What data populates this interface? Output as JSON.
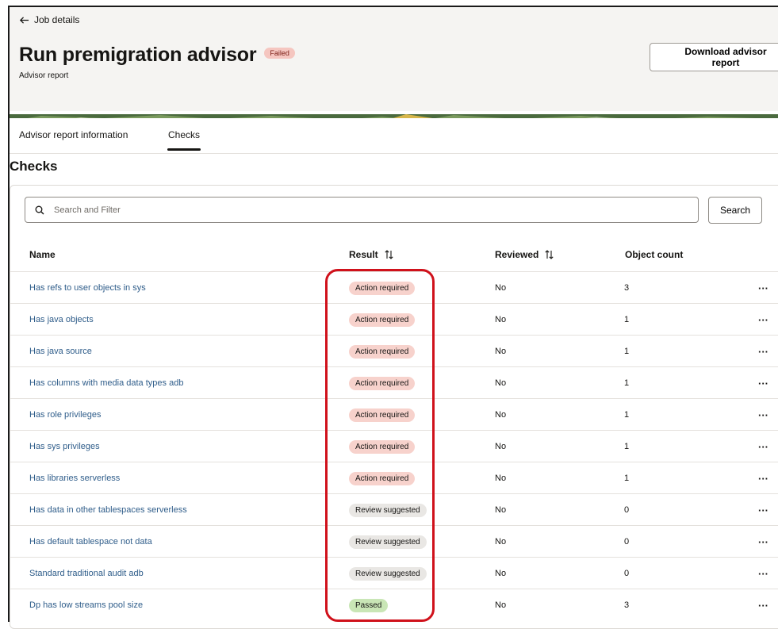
{
  "header": {
    "back_label": "Job details",
    "title": "Run premigration advisor",
    "status": "Failed",
    "subtitle": "Advisor report",
    "download_label": "Download advisor report"
  },
  "tabs": [
    {
      "label": "Advisor report information",
      "active": false
    },
    {
      "label": "Checks",
      "active": true
    }
  ],
  "section_title": "Checks",
  "search": {
    "placeholder": "Search and Filter",
    "button_label": "Search"
  },
  "columns": {
    "name": "Name",
    "result": "Result",
    "reviewed": "Reviewed",
    "object_count": "Object count"
  },
  "rows": [
    {
      "name": "Has refs to user objects in sys",
      "result": "Action required",
      "reviewed": "No",
      "count": "3"
    },
    {
      "name": "Has java objects",
      "result": "Action required",
      "reviewed": "No",
      "count": "1"
    },
    {
      "name": "Has java source",
      "result": "Action required",
      "reviewed": "No",
      "count": "1"
    },
    {
      "name": "Has columns with media data types adb",
      "result": "Action required",
      "reviewed": "No",
      "count": "1"
    },
    {
      "name": "Has role privileges",
      "result": "Action required",
      "reviewed": "No",
      "count": "1"
    },
    {
      "name": "Has sys privileges",
      "result": "Action required",
      "reviewed": "No",
      "count": "1"
    },
    {
      "name": "Has libraries serverless",
      "result": "Action required",
      "reviewed": "No",
      "count": "1"
    },
    {
      "name": "Has data in other tablespaces serverless",
      "result": "Review suggested",
      "reviewed": "No",
      "count": "0"
    },
    {
      "name": "Has default tablespace not data",
      "result": "Review suggested",
      "reviewed": "No",
      "count": "0"
    },
    {
      "name": "Standard traditional audit adb",
      "result": "Review suggested",
      "reviewed": "No",
      "count": "0"
    },
    {
      "name": "Dp has low streams pool size",
      "result": "Passed",
      "reviewed": "No",
      "count": "3"
    }
  ],
  "more_glyph": "···",
  "colors": {
    "highlight": "#d0111b",
    "link": "#2f5d8a",
    "failed_pill": "#f5c6c0"
  }
}
